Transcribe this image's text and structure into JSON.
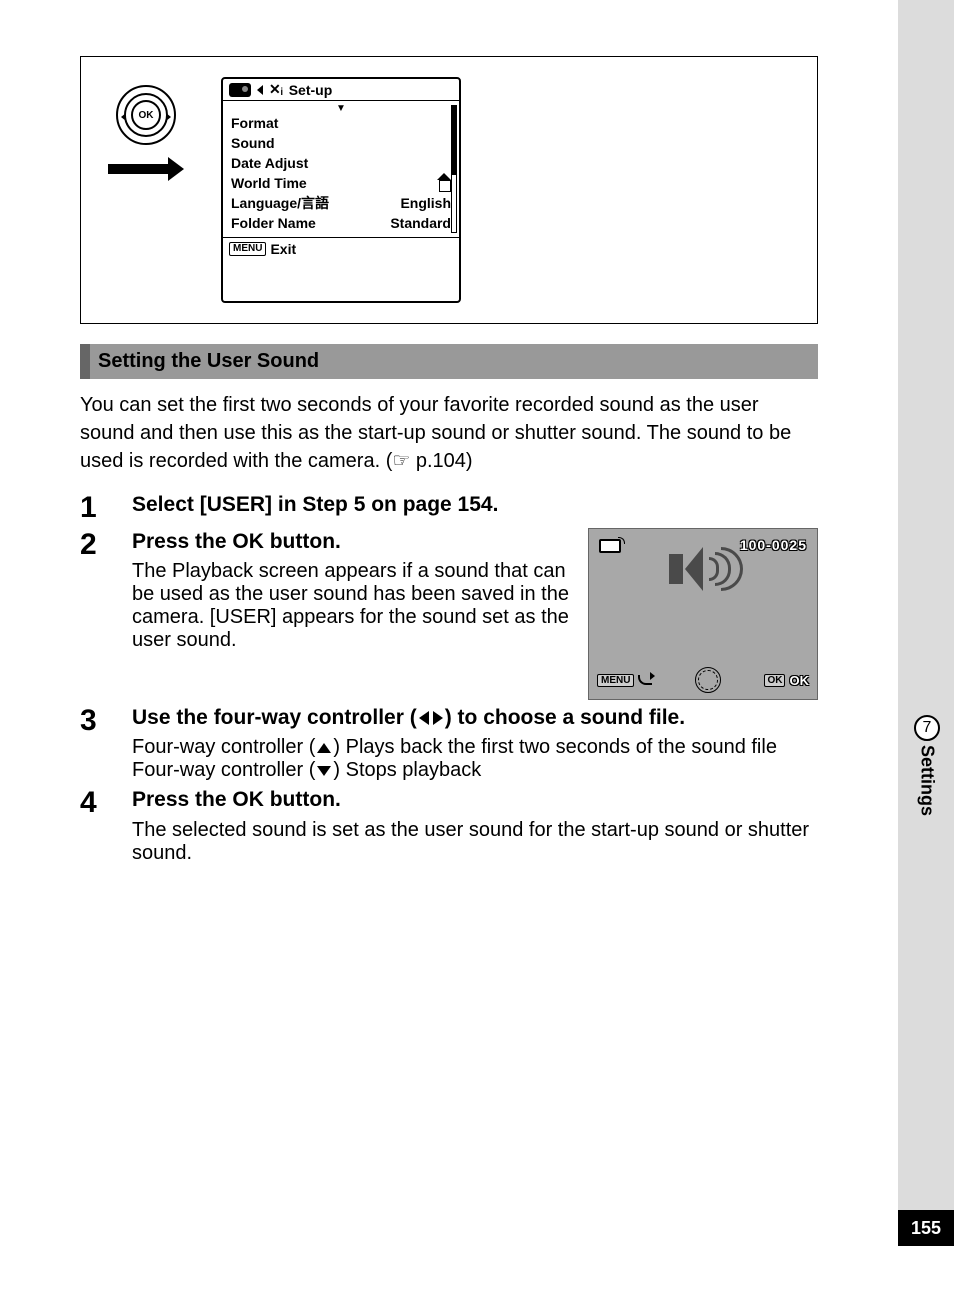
{
  "sidebar": {
    "chapter_num": "7",
    "chapter_label": "Settings"
  },
  "page_number": "155",
  "menu_screen": {
    "tab_title": "Set-up",
    "items": {
      "0": {
        "label": "Format",
        "value": ""
      },
      "1": {
        "label": "Sound",
        "value": ""
      },
      "2": {
        "label": "Date Adjust",
        "value": ""
      },
      "3": {
        "label": "World Time",
        "value": ""
      },
      "4": {
        "label": "Language/言語",
        "value": "English"
      },
      "5": {
        "label": "Folder Name",
        "value": "Standard"
      }
    },
    "footer_button": "MENU",
    "footer_label": "Exit"
  },
  "ok_label": "OK",
  "section_heading": "Setting the User Sound",
  "intro_para": "You can set the first two seconds of your favorite recorded sound as the user sound and then use this as the start-up sound or shutter sound. The sound to be used is recorded with the camera. (☞ p.104)",
  "steps": {
    "1": {
      "num": "1",
      "title": "Select [USER] in Step 5 on page 154."
    },
    "2": {
      "num": "2",
      "title": "Press the OK button.",
      "body": "The Playback screen appears if a sound that can be used as the user sound has been saved in the camera. [USER] appears for the sound set as the user sound."
    },
    "3": {
      "num": "3",
      "title_a": "Use the four-way controller (",
      "title_b": ") to choose a sound file.",
      "line1a": "Four-way controller (",
      "line1b": ") Plays back the first two seconds of the sound file",
      "line2a": "Four-way controller (",
      "line2b": ") Stops playback"
    },
    "4": {
      "num": "4",
      "title": "Press the OK button.",
      "body": "The selected sound is set as the user sound for the start-up sound or shutter sound."
    }
  },
  "playback": {
    "file_number": "100-0025",
    "menu_label": "MENU",
    "ok_box": "OK",
    "ok_label": "OK"
  }
}
